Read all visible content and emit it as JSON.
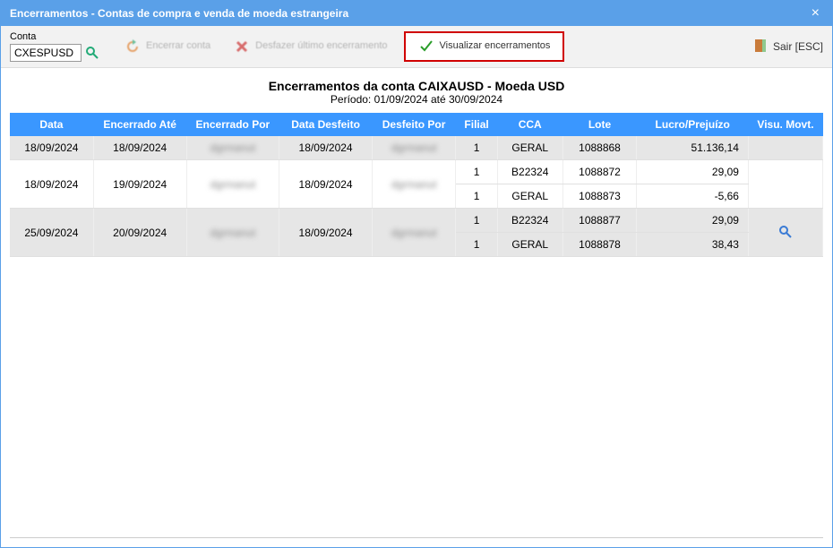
{
  "window": {
    "title": "Encerramentos - Contas de compra e venda de moeda estrangeira"
  },
  "toolbar": {
    "conta_label": "Conta",
    "conta_value": "CXESPUSD",
    "encerrar_label": "Encerrar conta",
    "desfazer_label": "Desfazer último encerramento",
    "visualizar_label": "Visualizar encerramentos",
    "sair_label": "Sair [ESC]"
  },
  "header": {
    "title": "Encerramentos da conta CAIXAUSD - Moeda USD",
    "period": "Período: 01/09/2024 até 30/09/2024"
  },
  "columns": {
    "data": "Data",
    "encerrado_ate": "Encerrado Até",
    "encerrado_por": "Encerrado Por",
    "data_desfeito": "Data Desfeito",
    "desfeito_por": "Desfeito Por",
    "filial": "Filial",
    "cca": "CCA",
    "lote": "Lote",
    "lucro": "Lucro/Prejuízo",
    "visu": "Visu. Movt."
  },
  "rows": [
    {
      "data": "18/09/2024",
      "encerrado_ate": "18/09/2024",
      "encerrado_por": "dgrmanut",
      "data_desfeito": "18/09/2024",
      "desfeito_por": "dgrmanut",
      "sub": [
        {
          "filial": "1",
          "cca": "GERAL",
          "lote": "1088868",
          "lucro": "51.136,14"
        }
      ],
      "shade": true,
      "show_view": false
    },
    {
      "data": "18/09/2024",
      "encerrado_ate": "19/09/2024",
      "encerrado_por": "dgrmanut",
      "data_desfeito": "18/09/2024",
      "desfeito_por": "dgrmanut",
      "sub": [
        {
          "filial": "1",
          "cca": "B22324",
          "lote": "1088872",
          "lucro": "29,09"
        },
        {
          "filial": "1",
          "cca": "GERAL",
          "lote": "1088873",
          "lucro": "-5,66"
        }
      ],
      "shade": false,
      "show_view": false
    },
    {
      "data": "25/09/2024",
      "encerrado_ate": "20/09/2024",
      "encerrado_por": "dgrmanut",
      "data_desfeito": "18/09/2024",
      "desfeito_por": "dgrmanut",
      "sub": [
        {
          "filial": "1",
          "cca": "B22324",
          "lote": "1088877",
          "lucro": "29,09"
        },
        {
          "filial": "1",
          "cca": "GERAL",
          "lote": "1088878",
          "lucro": "38,43"
        }
      ],
      "shade": true,
      "show_view": true
    }
  ]
}
